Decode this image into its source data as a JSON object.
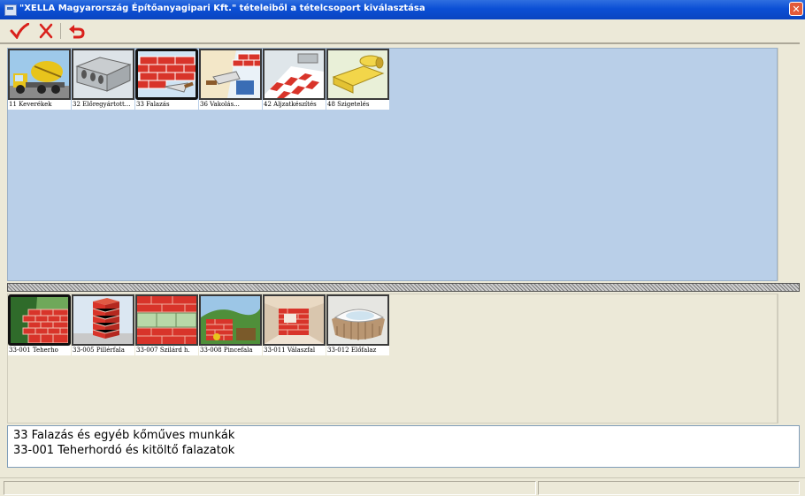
{
  "window": {
    "title": "\"XELLA Magyarország Építőanyagipari Kft.\" tételeiből a tételcsoport kiválasztása",
    "close_glyph": "✕"
  },
  "toolbar": {
    "ok_icon": "checkmark-icon",
    "cancel_icon": "x-icon",
    "back_icon": "undo-arrow-icon"
  },
  "groups": [
    {
      "caption": "11 Keverékek",
      "icon": "concrete-mixer-truck",
      "selected": false
    },
    {
      "caption": "32 Előregyártott...",
      "icon": "precast-elements",
      "selected": false
    },
    {
      "caption": "33 Falazás",
      "icon": "brick-wall-trowel",
      "selected": true
    },
    {
      "caption": "36 Vakolás...",
      "icon": "plastering",
      "selected": false
    },
    {
      "caption": "42 Aljzatkészítés",
      "icon": "floor-tiles",
      "selected": false
    },
    {
      "caption": "48 Szigetelés",
      "icon": "insulation-rolls",
      "selected": false
    }
  ],
  "subgroups": [
    {
      "caption": "33-001 Teherho",
      "icon": "brick-wall-garden",
      "selected": true
    },
    {
      "caption": "33-005 Pillérfala",
      "icon": "brick-pillar",
      "selected": false
    },
    {
      "caption": "33-007 Szilárd h.",
      "icon": "block-wall",
      "selected": false
    },
    {
      "caption": "33-008 Pincefala",
      "icon": "basement-wall",
      "selected": false
    },
    {
      "caption": "33-011 Válaszfal",
      "icon": "partition-wall",
      "selected": false
    },
    {
      "caption": "33-012 Előfalaz",
      "icon": "facing-wall-bath",
      "selected": false
    }
  ],
  "info": {
    "line1": "33 Falazás és egyéb kőműves munkák",
    "line2": "33-001 Teherhordó és kitöltő falazatok"
  },
  "colors": {
    "selection_pane": "#b9cfe8",
    "titlebar": "#0b4fd5"
  }
}
